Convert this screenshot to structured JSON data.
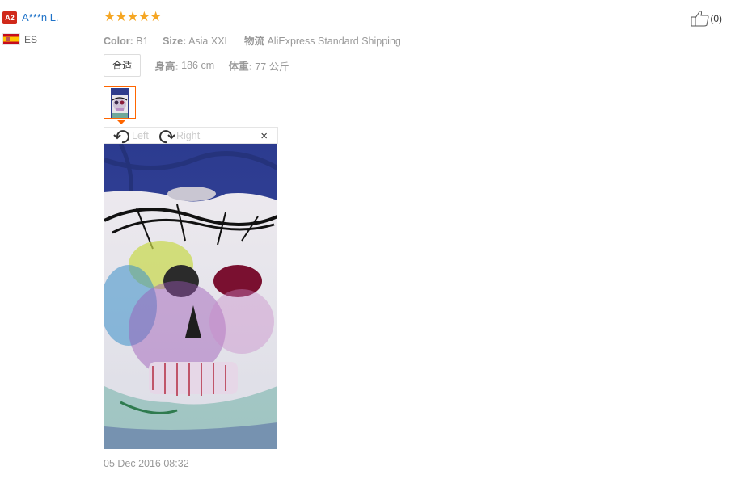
{
  "user": {
    "level_badge": "A2",
    "name": "A***n L.",
    "country_code": "ES"
  },
  "review": {
    "stars": "★★★★★",
    "rating": 5,
    "color_label": "Color:",
    "color_value": "B1",
    "size_label": "Size:",
    "size_value": "Asia XXL",
    "shipping_label": "物流",
    "shipping_value": "AliExpress Standard Shipping",
    "fit_tag": "合适",
    "height_label": "身高:",
    "height_value": "186 cm",
    "weight_label": "体重:",
    "weight_value": "77 公斤"
  },
  "viewer": {
    "rotate_left": "Left",
    "rotate_right": "Right",
    "close": "×"
  },
  "like": {
    "count": "(0)"
  },
  "date": "05 Dec 2016 08:32",
  "colors": {
    "accent": "#f60",
    "stars": "#f5a623",
    "link": "#1f73c9",
    "badge": "#d0291a"
  }
}
